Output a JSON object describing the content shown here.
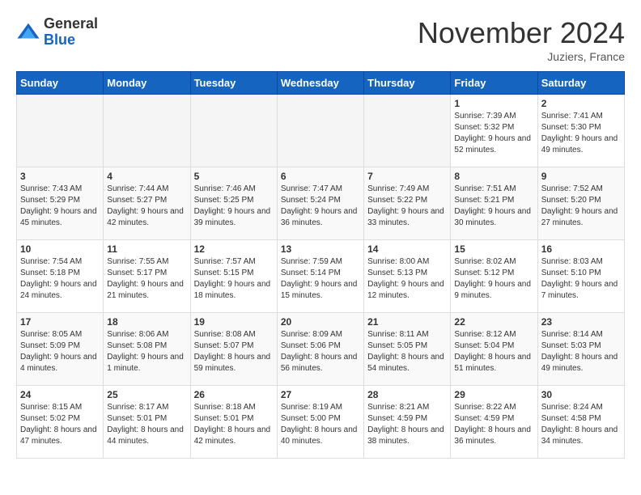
{
  "header": {
    "logo_general": "General",
    "logo_blue": "Blue",
    "month": "November 2024",
    "location": "Juziers, France"
  },
  "days_of_week": [
    "Sunday",
    "Monday",
    "Tuesday",
    "Wednesday",
    "Thursday",
    "Friday",
    "Saturday"
  ],
  "weeks": [
    [
      {
        "day": "",
        "info": ""
      },
      {
        "day": "",
        "info": ""
      },
      {
        "day": "",
        "info": ""
      },
      {
        "day": "",
        "info": ""
      },
      {
        "day": "",
        "info": ""
      },
      {
        "day": "1",
        "info": "Sunrise: 7:39 AM\nSunset: 5:32 PM\nDaylight: 9 hours and 52 minutes."
      },
      {
        "day": "2",
        "info": "Sunrise: 7:41 AM\nSunset: 5:30 PM\nDaylight: 9 hours and 49 minutes."
      }
    ],
    [
      {
        "day": "3",
        "info": "Sunrise: 7:43 AM\nSunset: 5:29 PM\nDaylight: 9 hours and 45 minutes."
      },
      {
        "day": "4",
        "info": "Sunrise: 7:44 AM\nSunset: 5:27 PM\nDaylight: 9 hours and 42 minutes."
      },
      {
        "day": "5",
        "info": "Sunrise: 7:46 AM\nSunset: 5:25 PM\nDaylight: 9 hours and 39 minutes."
      },
      {
        "day": "6",
        "info": "Sunrise: 7:47 AM\nSunset: 5:24 PM\nDaylight: 9 hours and 36 minutes."
      },
      {
        "day": "7",
        "info": "Sunrise: 7:49 AM\nSunset: 5:22 PM\nDaylight: 9 hours and 33 minutes."
      },
      {
        "day": "8",
        "info": "Sunrise: 7:51 AM\nSunset: 5:21 PM\nDaylight: 9 hours and 30 minutes."
      },
      {
        "day": "9",
        "info": "Sunrise: 7:52 AM\nSunset: 5:20 PM\nDaylight: 9 hours and 27 minutes."
      }
    ],
    [
      {
        "day": "10",
        "info": "Sunrise: 7:54 AM\nSunset: 5:18 PM\nDaylight: 9 hours and 24 minutes."
      },
      {
        "day": "11",
        "info": "Sunrise: 7:55 AM\nSunset: 5:17 PM\nDaylight: 9 hours and 21 minutes."
      },
      {
        "day": "12",
        "info": "Sunrise: 7:57 AM\nSunset: 5:15 PM\nDaylight: 9 hours and 18 minutes."
      },
      {
        "day": "13",
        "info": "Sunrise: 7:59 AM\nSunset: 5:14 PM\nDaylight: 9 hours and 15 minutes."
      },
      {
        "day": "14",
        "info": "Sunrise: 8:00 AM\nSunset: 5:13 PM\nDaylight: 9 hours and 12 minutes."
      },
      {
        "day": "15",
        "info": "Sunrise: 8:02 AM\nSunset: 5:12 PM\nDaylight: 9 hours and 9 minutes."
      },
      {
        "day": "16",
        "info": "Sunrise: 8:03 AM\nSunset: 5:10 PM\nDaylight: 9 hours and 7 minutes."
      }
    ],
    [
      {
        "day": "17",
        "info": "Sunrise: 8:05 AM\nSunset: 5:09 PM\nDaylight: 9 hours and 4 minutes."
      },
      {
        "day": "18",
        "info": "Sunrise: 8:06 AM\nSunset: 5:08 PM\nDaylight: 9 hours and 1 minute."
      },
      {
        "day": "19",
        "info": "Sunrise: 8:08 AM\nSunset: 5:07 PM\nDaylight: 8 hours and 59 minutes."
      },
      {
        "day": "20",
        "info": "Sunrise: 8:09 AM\nSunset: 5:06 PM\nDaylight: 8 hours and 56 minutes."
      },
      {
        "day": "21",
        "info": "Sunrise: 8:11 AM\nSunset: 5:05 PM\nDaylight: 8 hours and 54 minutes."
      },
      {
        "day": "22",
        "info": "Sunrise: 8:12 AM\nSunset: 5:04 PM\nDaylight: 8 hours and 51 minutes."
      },
      {
        "day": "23",
        "info": "Sunrise: 8:14 AM\nSunset: 5:03 PM\nDaylight: 8 hours and 49 minutes."
      }
    ],
    [
      {
        "day": "24",
        "info": "Sunrise: 8:15 AM\nSunset: 5:02 PM\nDaylight: 8 hours and 47 minutes."
      },
      {
        "day": "25",
        "info": "Sunrise: 8:17 AM\nSunset: 5:01 PM\nDaylight: 8 hours and 44 minutes."
      },
      {
        "day": "26",
        "info": "Sunrise: 8:18 AM\nSunset: 5:01 PM\nDaylight: 8 hours and 42 minutes."
      },
      {
        "day": "27",
        "info": "Sunrise: 8:19 AM\nSunset: 5:00 PM\nDaylight: 8 hours and 40 minutes."
      },
      {
        "day": "28",
        "info": "Sunrise: 8:21 AM\nSunset: 4:59 PM\nDaylight: 8 hours and 38 minutes."
      },
      {
        "day": "29",
        "info": "Sunrise: 8:22 AM\nSunset: 4:59 PM\nDaylight: 8 hours and 36 minutes."
      },
      {
        "day": "30",
        "info": "Sunrise: 8:24 AM\nSunset: 4:58 PM\nDaylight: 8 hours and 34 minutes."
      }
    ]
  ]
}
